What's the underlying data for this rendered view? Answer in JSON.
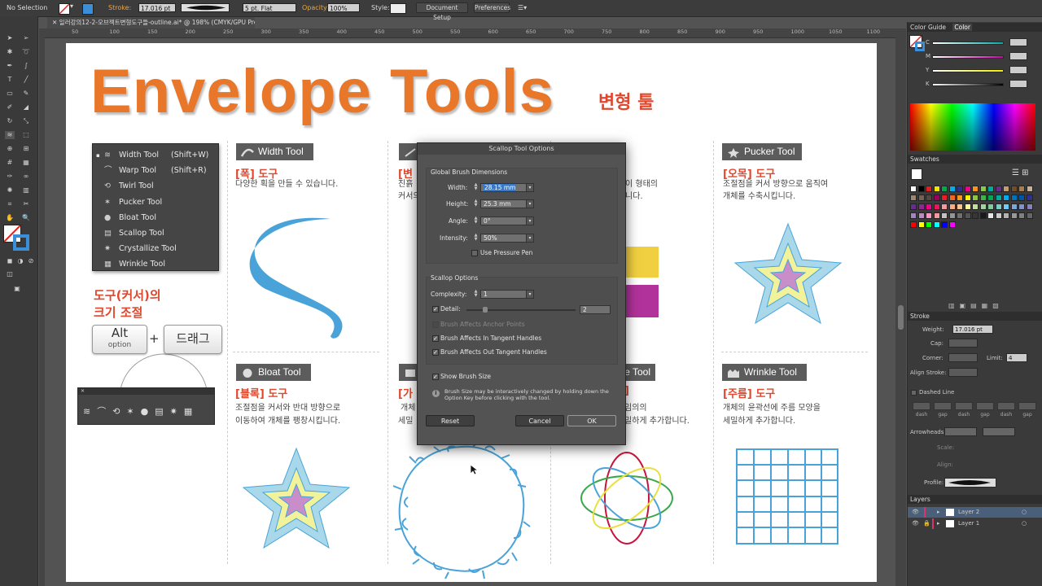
{
  "control_bar": {
    "selection": "No Selection",
    "stroke_label": "Stroke:",
    "stroke_value": "17.016 pt",
    "brush": "5 pt. Flat",
    "opacity_label": "Opacity:",
    "opacity_value": "100%",
    "style_label": "Style:",
    "document_setup": "Document Setup",
    "preferences": "Preferences"
  },
  "document_tab": "일러강의12-2-오브젝트변형도구들-outline.ai* @ 198% (CMYK/GPU Preview)",
  "ruler_ticks": [
    "50",
    "100",
    "150",
    "200",
    "250",
    "300",
    "350",
    "400",
    "450",
    "500",
    "550",
    "600",
    "650",
    "700",
    "750",
    "800",
    "850",
    "900",
    "950",
    "1000",
    "1050",
    "1100"
  ],
  "artwork": {
    "title": "Envelope Tools",
    "subtitle": "변형 툴",
    "tool_menu": [
      {
        "name": "Width Tool",
        "shortcut": "(Shift+W)"
      },
      {
        "name": "Warp Tool",
        "shortcut": "(Shift+R)"
      },
      {
        "name": "Twirl Tool",
        "shortcut": ""
      },
      {
        "name": "Pucker Tool",
        "shortcut": ""
      },
      {
        "name": "Bloat Tool",
        "shortcut": ""
      },
      {
        "name": "Scallop Tool",
        "shortcut": ""
      },
      {
        "name": "Crystallize Tool",
        "shortcut": ""
      },
      {
        "name": "Wrinkle Tool",
        "shortcut": ""
      }
    ],
    "resize_title_1": "도구(커서)의",
    "resize_title_2": "크기 조절",
    "alt_key": "Alt",
    "alt_sub": "option",
    "plus": "+",
    "drag_key": "드래그",
    "cells": [
      {
        "tag": "Width Tool",
        "title": "[폭] 도구",
        "desc1": "다양한 획을 만들 수 있습니다.",
        "desc2": ""
      },
      {
        "tag": "Pucker Tool",
        "title": "[오목] 도구",
        "desc1": "조절점을 커서 방향으로 움직여",
        "desc2": "개체를 수축시킵니다."
      },
      {
        "tag": "Bloat Tool",
        "title": "[블록] 도구",
        "desc1": "조절점을 커서와 반대 방향으로",
        "desc2": "이동하여 개체를 팽창시킵니다."
      },
      {
        "tag": "Wrinkle Tool",
        "title": "[주름] 도구",
        "desc1": "개체의 윤곽선에 주름 모양을",
        "desc2": "세밀하게 추가합니다."
      }
    ],
    "partial": {
      "title_b": "[변",
      "desc_b1": "진흙",
      "desc_b2": "커서의",
      "desc_c1": "이 형태의",
      "desc_c2": "니다.",
      "title_e": "[가",
      "desc_e1": "개체",
      "desc_e2": "세밀",
      "tag_f": "e Tool",
      "title_f": "]",
      "desc_f1": "임의의",
      "desc_f2": "밀하게 추가합니다."
    }
  },
  "dialog": {
    "title": "Scallop Tool Options",
    "global_label": "Global Brush Dimensions",
    "width_label": "Width:",
    "width_value": "28.15 mm",
    "height_label": "Height:",
    "height_value": "25.3 mm",
    "angle_label": "Angle:",
    "angle_value": "0°",
    "intensity_label": "Intensity:",
    "intensity_value": "50%",
    "pressure_label": "Use Pressure Pen",
    "scallop_label": "Scallop Options",
    "complexity_label": "Complexity:",
    "complexity_value": "1",
    "detail_label": "Detail:",
    "detail_value": "2",
    "anchor_label": "Brush Affects Anchor Points",
    "in_label": "Brush Affects In Tangent Handles",
    "out_label": "Brush Affects Out Tangent Handles",
    "show_label": "Show Brush Size",
    "info": "Brush Size may be interactively changed by holding down the Option Key before clicking with the tool.",
    "reset": "Reset",
    "cancel": "Cancel",
    "ok": "OK"
  },
  "panels": {
    "color_guide": "Color Guide",
    "color": "Color",
    "c_label": "C",
    "m_label": "M",
    "y_label": "Y",
    "k_label": "K",
    "swatches": "Swatches",
    "stroke": "Stroke",
    "weight_label": "Weight:",
    "weight_value": "17.016 pt",
    "cap_label": "Cap:",
    "corner_label": "Corner:",
    "limit_label": "Limit:",
    "limit_value": "4",
    "align_label": "Align Stroke:",
    "dashed_label": "Dashed Line",
    "dash_labels": [
      "dash",
      "gap",
      "dash",
      "gap",
      "dash",
      "gap"
    ],
    "arrowheads_label": "Arrowheads:",
    "scale_label": "Scale:",
    "align2_label": "Align:",
    "profile_label": "Profile:",
    "layers": "Layers",
    "layer2": "Layer 2",
    "layer1": "Layer 1"
  },
  "colors": {
    "title_orange": "#e9772a",
    "accent_red": "#e0472c",
    "blue_stroke": "#4aa3d8",
    "star_outer": "#a8d8ea",
    "star_mid": "#f2f29a",
    "star_inner": "#c98ec9"
  }
}
